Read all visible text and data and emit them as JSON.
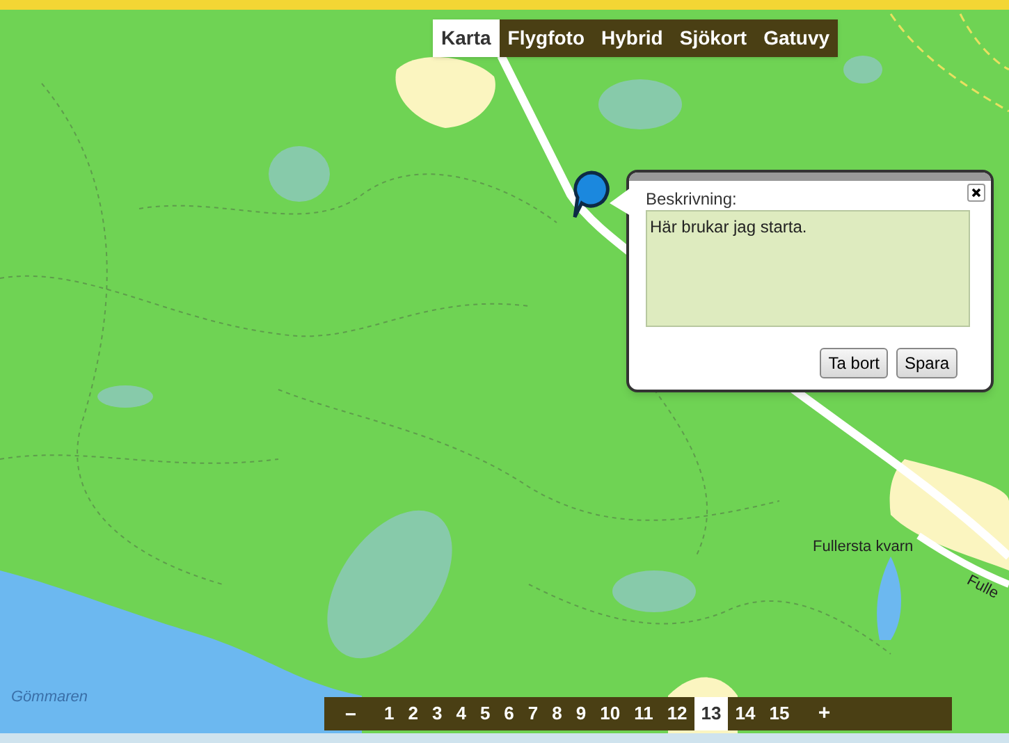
{
  "map_types": [
    {
      "label": "Karta",
      "selected": true
    },
    {
      "label": "Flygfoto",
      "selected": false
    },
    {
      "label": "Hybrid",
      "selected": false
    },
    {
      "label": "Sjökort",
      "selected": false
    },
    {
      "label": "Gatuvy",
      "selected": false
    }
  ],
  "popup": {
    "label": "Beskrivning:",
    "value": "Här brukar jag starta.",
    "buttons": [
      "Ta bort",
      "Spara"
    ]
  },
  "map_labels": [
    {
      "text": "Fullersta kvarn",
      "kind": "place"
    },
    {
      "text": "Fulle",
      "kind": "road"
    },
    {
      "text": "Gömmaren",
      "kind": "water"
    }
  ],
  "zoom_bar": {
    "minus": "−",
    "plus": "+",
    "levels": [
      {
        "label": "1",
        "selected": false
      },
      {
        "label": "2",
        "selected": false
      },
      {
        "label": "3",
        "selected": false
      },
      {
        "label": "4",
        "selected": false
      },
      {
        "label": "5",
        "selected": false
      },
      {
        "label": "6",
        "selected": false
      },
      {
        "label": "7",
        "selected": false
      },
      {
        "label": "8",
        "selected": false
      },
      {
        "label": "9",
        "selected": false
      },
      {
        "label": "10",
        "selected": false
      },
      {
        "label": "11",
        "selected": false
      },
      {
        "label": "12",
        "selected": false
      },
      {
        "label": "13",
        "selected": true
      },
      {
        "label": "14",
        "selected": false
      },
      {
        "label": "15",
        "selected": false
      }
    ]
  }
}
